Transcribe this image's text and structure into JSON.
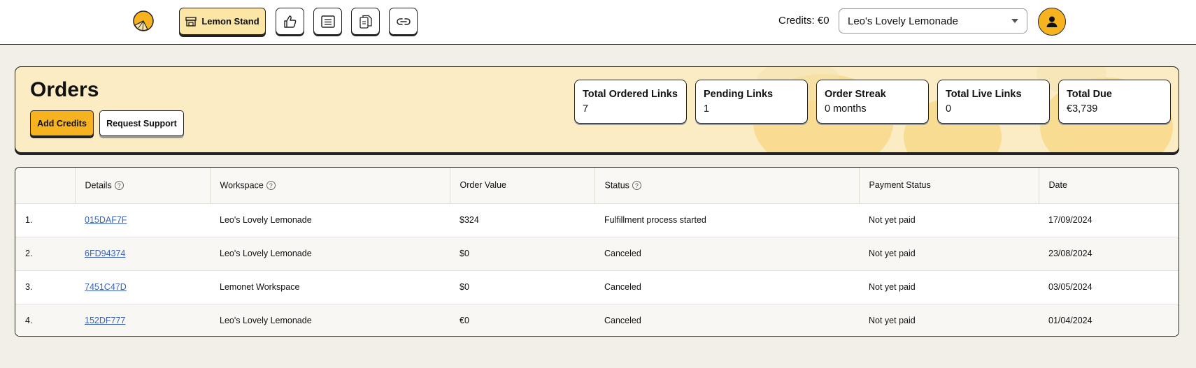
{
  "topbar": {
    "brand_label": "Lemon Stand",
    "credits": "Credits: €0",
    "workspace_selected": "Leo's Lovely Lemonade",
    "icons": [
      "thumbs-up-icon",
      "list-icon",
      "documents-icon",
      "link-icon"
    ]
  },
  "header": {
    "title": "Orders",
    "add_credits": "Add Credits",
    "request_support": "Request Support",
    "stats": [
      {
        "label": "Total Ordered Links",
        "value": "7"
      },
      {
        "label": "Pending Links",
        "value": "1"
      },
      {
        "label": "Order Streak",
        "value": "0 months"
      },
      {
        "label": "Total Live Links",
        "value": "0"
      },
      {
        "label": "Total Due",
        "value": "€3,739"
      }
    ]
  },
  "table": {
    "columns": [
      "",
      "Details",
      "Workspace",
      "Order Value",
      "Status",
      "Payment Status",
      "Date"
    ],
    "rows": [
      {
        "num": "1.",
        "id": "015DAF7F",
        "workspace": "Leo's Lovely Lemonade",
        "value": "$324",
        "status": "Fulfillment process started",
        "payment": "Not yet paid",
        "date": "17/09/2024"
      },
      {
        "num": "2.",
        "id": "6FD94374",
        "workspace": "Leo's Lovely Lemonade",
        "value": "$0",
        "status": "Canceled",
        "payment": "Not yet paid",
        "date": "23/08/2024"
      },
      {
        "num": "3.",
        "id": "7451C47D",
        "workspace": "Lemonet Workspace",
        "value": "$0",
        "status": "Canceled",
        "payment": "Not yet paid",
        "date": "03/05/2024"
      },
      {
        "num": "4.",
        "id": "152DF777",
        "workspace": "Leo's Lovely Lemonade",
        "value": "€0",
        "status": "Canceled",
        "payment": "Not yet paid",
        "date": "01/04/2024"
      }
    ]
  },
  "colors": {
    "accent": "#f7b31f",
    "panel": "#fbecc3",
    "link": "#3a63b8"
  }
}
